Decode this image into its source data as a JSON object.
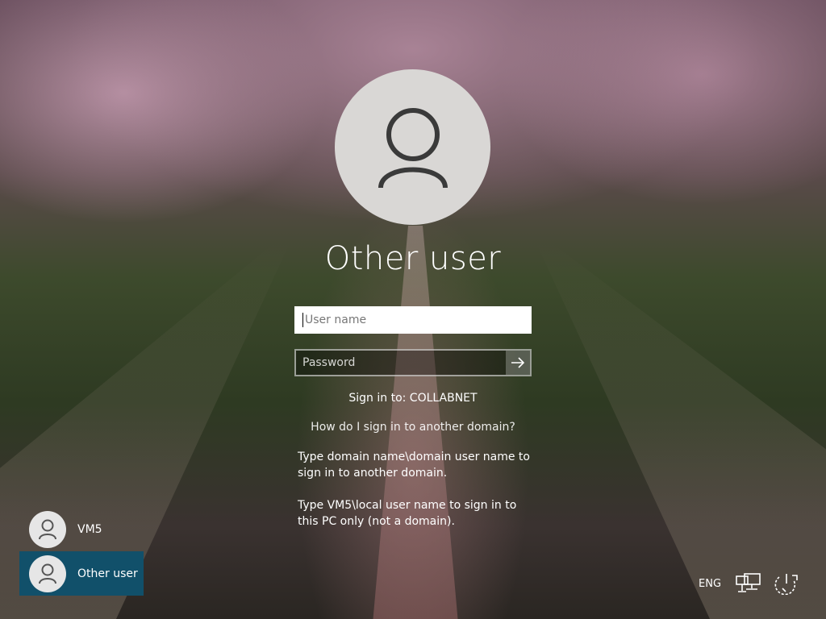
{
  "login": {
    "title": "Other user",
    "username_placeholder": "User name",
    "password_placeholder": "Password",
    "sign_in_to": "Sign in to: COLLABNET",
    "help_link": "How do I sign in to another domain?",
    "info_domain": "Type domain name\\domain user name to sign in to another domain.",
    "info_local": "Type VM5\\local user name to sign in to this PC only (not a domain).",
    "avatar_icon": "user-icon",
    "submit_icon": "arrow-right-icon"
  },
  "users": [
    {
      "name": "VM5",
      "selected": false
    },
    {
      "name": "Other user",
      "selected": true
    }
  ],
  "tray": {
    "language": "ENG",
    "network_icon": "network-icon",
    "power_icon": "power-icon"
  },
  "colors": {
    "selected_tile": "#11506a",
    "avatar_bg": "#d9d7d5"
  }
}
